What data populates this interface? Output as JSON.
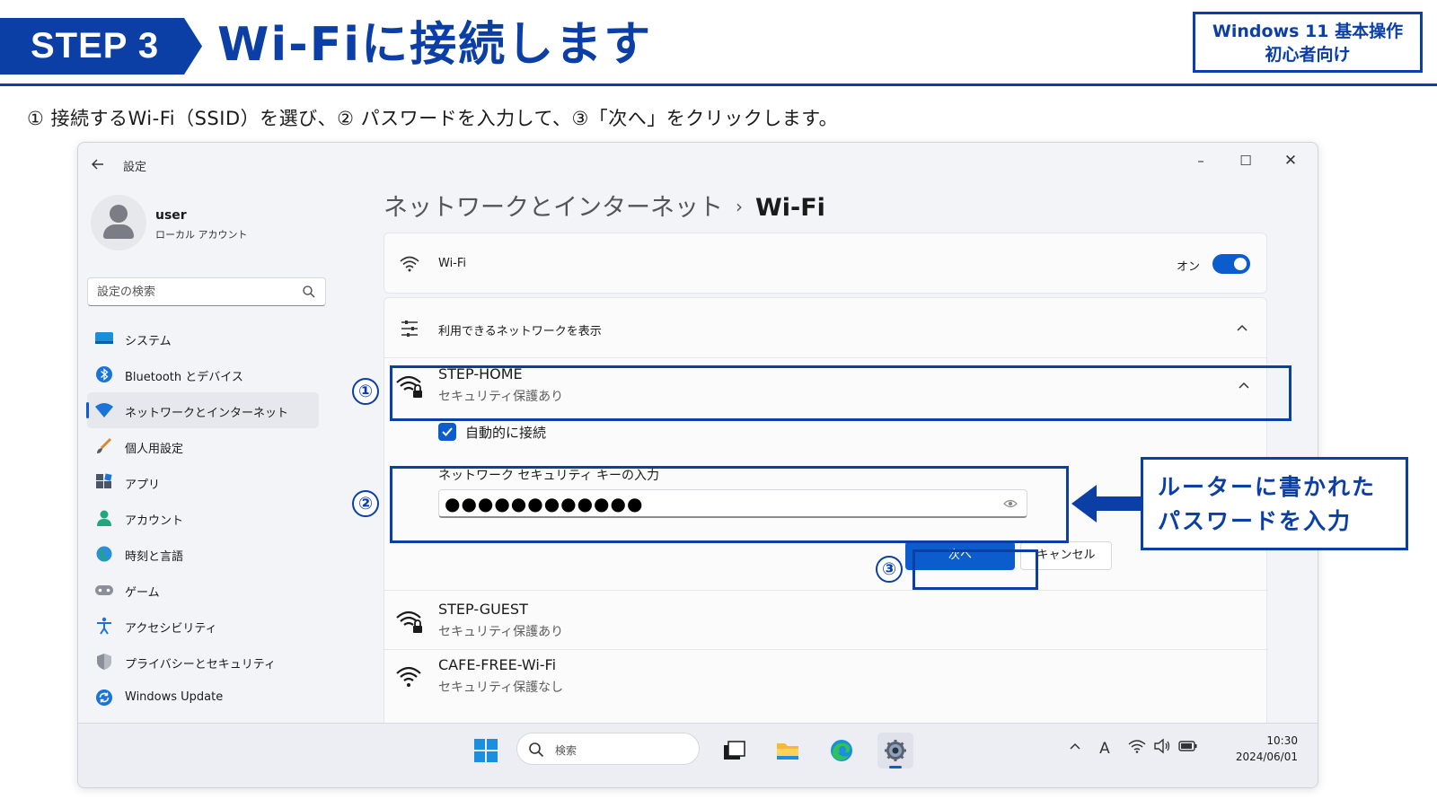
{
  "slide": {
    "step_label": "STEP 3",
    "title": "Wi-Fiに接続します",
    "badge_line1": "Windows 11 基本操作",
    "badge_line2": "初心者向け",
    "instruction": "① 接続するWi-Fi（SSID）を選び、② パスワードを入力して、③「次へ」をクリックします。",
    "accent_color": "#0b3fa6"
  },
  "window": {
    "title": "設定",
    "controls": {
      "minimize": "–",
      "maximize": "☐",
      "close": "✕"
    }
  },
  "profile": {
    "name": "user",
    "account_type": "ローカル アカウント"
  },
  "search": {
    "placeholder": "設定の検索"
  },
  "sidebar": {
    "items": [
      {
        "label": "システム",
        "icon": "system-icon"
      },
      {
        "label": "Bluetooth とデバイス",
        "icon": "bluetooth-icon"
      },
      {
        "label": "ネットワークとインターネット",
        "icon": "network-icon",
        "active": true
      },
      {
        "label": "個人用設定",
        "icon": "brush-icon"
      },
      {
        "label": "アプリ",
        "icon": "apps-icon"
      },
      {
        "label": "アカウント",
        "icon": "account-icon"
      },
      {
        "label": "時刻と言語",
        "icon": "globe-icon"
      },
      {
        "label": "ゲーム",
        "icon": "gamepad-icon"
      },
      {
        "label": "アクセシビリティ",
        "icon": "accessibility-icon"
      },
      {
        "label": "プライバシーとセキュリティ",
        "icon": "shield-icon"
      },
      {
        "label": "Windows Update",
        "icon": "update-icon"
      }
    ]
  },
  "breadcrumb": {
    "parent": "ネットワークとインターネット",
    "separator": "›",
    "current": "Wi-Fi"
  },
  "wifi_card": {
    "label": "Wi-Fi",
    "state": "オン",
    "enabled": true
  },
  "available": {
    "label": "利用できるネットワークを表示"
  },
  "networks": [
    {
      "name": "STEP-HOME",
      "security": "セキュリティ保護あり",
      "secured": true,
      "expanded": true
    },
    {
      "name": "STEP-GUEST",
      "security": "セキュリティ保護あり",
      "secured": true
    },
    {
      "name": "CAFE-FREE-Wi-Fi",
      "security": "セキュリティ保護なし",
      "secured": false
    }
  ],
  "connect_form": {
    "auto_connect_label": "自動的に接続",
    "auto_connect_checked": true,
    "key_label": "ネットワーク セキュリティ キーの入力",
    "key_value": "●●●●●●●●●●●●",
    "next_label": "次へ",
    "cancel_label": "キャンセル"
  },
  "taskbar": {
    "search_text": "検索",
    "ime_indicator": "A",
    "time": "10:30",
    "date": "2024/06/01"
  },
  "annotations": {
    "marker_1": "①",
    "marker_2": "②",
    "marker_3": "③",
    "callout_line1": "ルーターに書かれた",
    "callout_line2": "パスワードを入力"
  }
}
